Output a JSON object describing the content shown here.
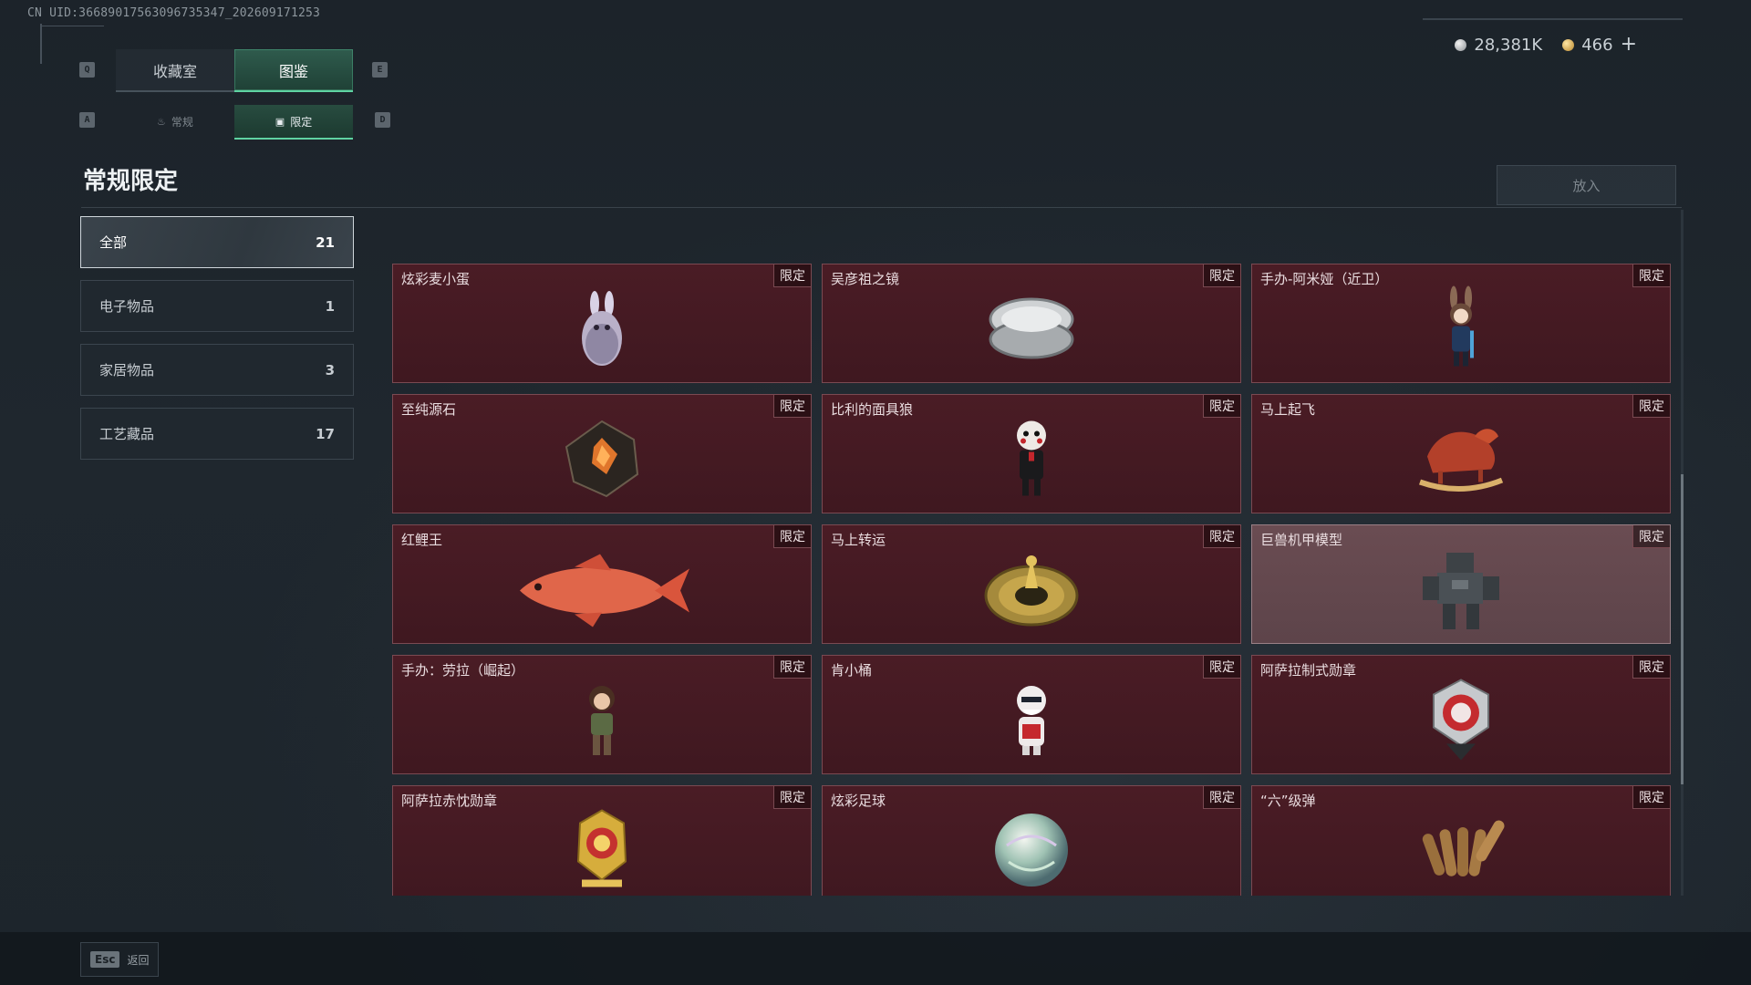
{
  "uid": "CN UID:3668901756309673534​7_202609171253",
  "currency": {
    "silver": "28,381K",
    "gold": "466",
    "plus": "+"
  },
  "keys": {
    "prev_tab": "Q",
    "next_tab": "E",
    "prev_sub": "A",
    "next_sub": "D"
  },
  "tabs": [
    {
      "label": "收藏室",
      "active": false
    },
    {
      "label": "图鉴",
      "active": true
    }
  ],
  "subtabs": [
    {
      "label": "常规",
      "active": false
    },
    {
      "label": "限定",
      "active": true
    }
  ],
  "section_title": "常规限定",
  "put_button": "放入",
  "categories": [
    {
      "label": "全部",
      "count": "21",
      "active": true
    },
    {
      "label": "电子物品",
      "count": "1",
      "active": false
    },
    {
      "label": "家居物品",
      "count": "3",
      "active": false
    },
    {
      "label": "工艺藏品",
      "count": "17",
      "active": false
    }
  ],
  "tag_label": "限定",
  "items": [
    {
      "name": "炫彩麦小蛋",
      "icon": "bunny-egg-icon"
    },
    {
      "name": "吴彦祖之镜",
      "icon": "compact-mirror-icon"
    },
    {
      "name": "手办-阿米娅（近卫）",
      "icon": "figurine-icon"
    },
    {
      "name": "至纯源石",
      "icon": "crystal-icon"
    },
    {
      "name": "比利的面具狼",
      "icon": "puppet-icon"
    },
    {
      "name": "马上起飞",
      "icon": "rocking-horse-icon"
    },
    {
      "name": "红鲤王",
      "icon": "carp-icon"
    },
    {
      "name": "马上转运",
      "icon": "compass-disc-icon"
    },
    {
      "name": "巨兽机甲模型",
      "icon": "mech-icon"
    },
    {
      "name": "手办：劳拉（崛起）",
      "icon": "figurine-icon"
    },
    {
      "name": "肯小桶",
      "icon": "colonel-icon"
    },
    {
      "name": "阿萨拉制式勋章",
      "icon": "medal-icon"
    },
    {
      "name": "阿萨拉赤忱勋章",
      "icon": "gold-medal-icon"
    },
    {
      "name": "炫彩足球",
      "icon": "ball-icon"
    },
    {
      "name": "“六”级弹",
      "icon": "bullets-icon"
    }
  ],
  "esc": {
    "key": "Esc",
    "label": "返回"
  }
}
